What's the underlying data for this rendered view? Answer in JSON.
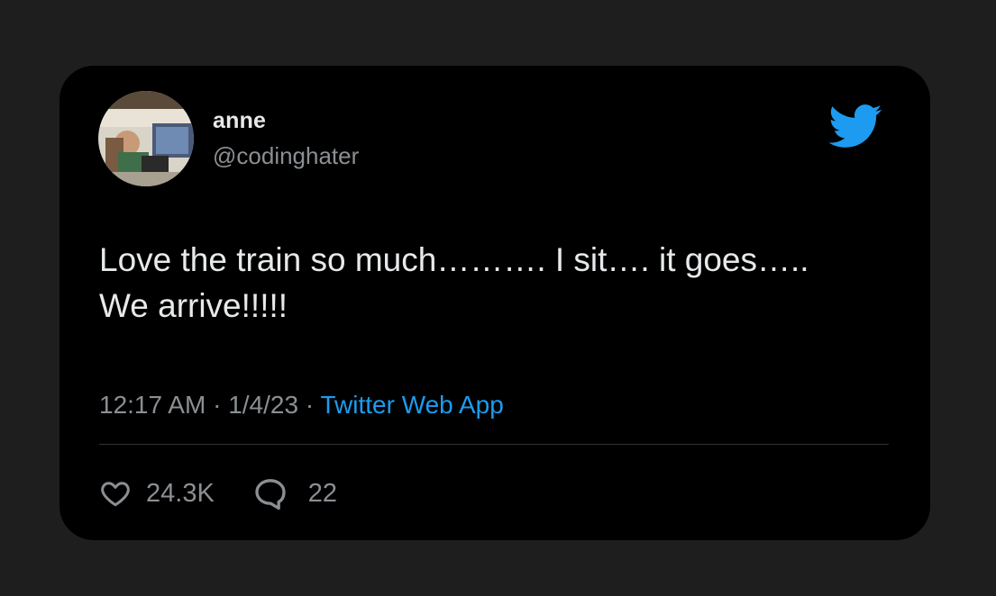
{
  "tweet": {
    "author": {
      "name": "anne",
      "handle": "@codinghater",
      "avatar_icon": "profile-photo"
    },
    "brand_icon": "twitter-bird-icon",
    "text": "Love the train so much………. I sit…. it goes….. We arrive!!!!!",
    "time": "12:17 AM",
    "date": "1/4/23",
    "separator": "·",
    "source": "Twitter Web App",
    "likes": "24.3K",
    "replies": "22"
  },
  "colors": {
    "page_background": "#1e1e1e",
    "card_background": "#000000",
    "primary_text": "#e7e9ea",
    "secondary_text": "#8b8f93",
    "accent": "#1d9bf0",
    "divider": "#2f3336"
  }
}
